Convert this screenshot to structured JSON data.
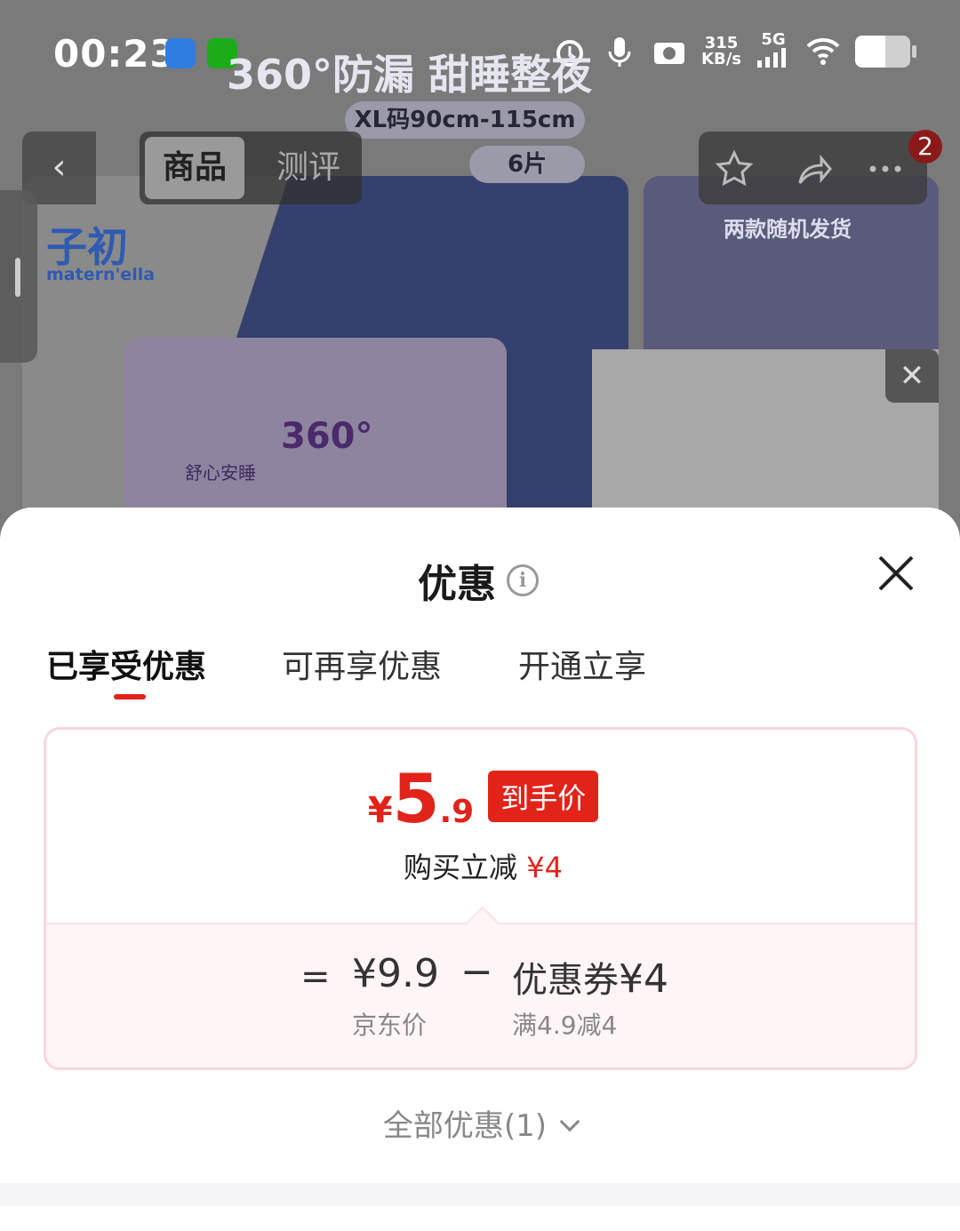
{
  "status_bar": {
    "time": "00:23",
    "net_speed_value": "315",
    "net_speed_unit": "KB/s",
    "network": "5G",
    "icons": [
      "screenshot-app-icon",
      "wechat-icon",
      "alarm-icon",
      "mic-icon",
      "camera-icon",
      "signal-icon",
      "wifi-icon",
      "battery-icon"
    ]
  },
  "product_nav": {
    "tabs": [
      {
        "label": "商品"
      },
      {
        "label": "测评"
      }
    ],
    "notification_count": "2",
    "icons": [
      "back-icon",
      "star-icon",
      "share-icon",
      "more-icon"
    ]
  },
  "banner": {
    "headline": "360°防漏 甜睡整夜",
    "size_pill": "XL码90cm-115cm",
    "count_pill": "6片",
    "brand_cn": "子初",
    "brand_en": "matern'ella",
    "pack_badge": "360°",
    "pack_label": "舒心安睡",
    "side_title": "两款随机发货"
  },
  "sheet": {
    "title": "优惠",
    "tabs": [
      {
        "label": "已享受优惠",
        "active": true
      },
      {
        "label": "可再享优惠",
        "active": false
      },
      {
        "label": "开通立享",
        "active": false
      }
    ],
    "final_price": {
      "currency": "¥",
      "integer": "5",
      "decimal": ".9",
      "tag": "到手价"
    },
    "instant_discount": {
      "label": "购买立减",
      "amount": "¥4"
    },
    "breakdown": {
      "equals": "=",
      "jd_price": "¥9.9",
      "jd_price_label": "京东价",
      "minus": "−",
      "coupon_label": "优惠券",
      "coupon_amount": "¥4",
      "coupon_condition": "满4.9减4"
    },
    "all_offers": "全部优惠(1)",
    "accent_color": "#e2231a"
  }
}
